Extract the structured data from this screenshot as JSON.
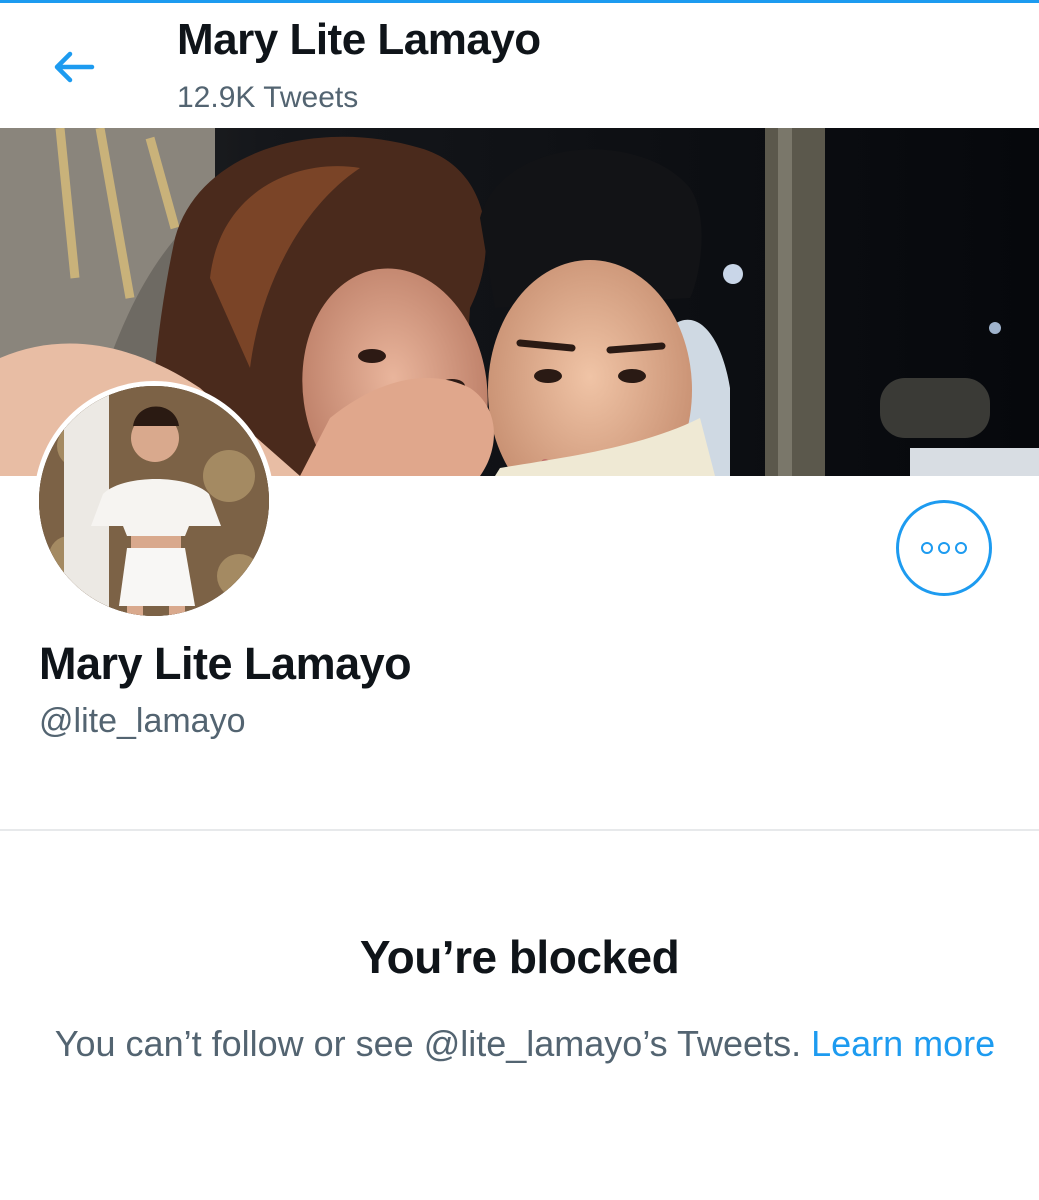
{
  "header": {
    "back_icon": "arrow-left-icon",
    "title": "Mary Lite Lamayo",
    "subtitle": "12.9K Tweets"
  },
  "profile": {
    "name": "Mary Lite Lamayo",
    "handle": "@lite_lamayo",
    "more_icon": "more-options-icon"
  },
  "blocked": {
    "title": "You’re blocked",
    "message": "You can’t follow or see @lite_lamayo’s Tweets.",
    "link": "Learn more"
  },
  "colors": {
    "accent": "#1d9bf0",
    "secondary_text": "#536471",
    "primary_text": "#0f1419"
  }
}
